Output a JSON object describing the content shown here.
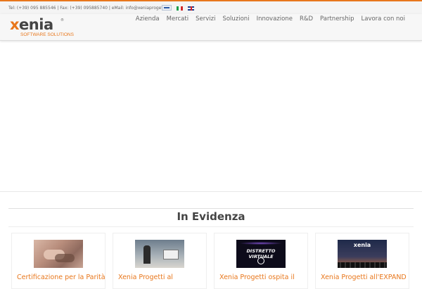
{
  "topbar": {
    "contact": "Tel: (+39) 095 885546 | Fax: (+39) 095885740 | eMail: info@xeniaprogetti.it",
    "languages": [
      "Italiano",
      "English"
    ]
  },
  "brand": {
    "name_x": "x",
    "name_rest": "enia",
    "registered": "®",
    "tagline": "SOFTWARE SOLUTIONS",
    "accent_color": "#e8771c"
  },
  "nav": {
    "items": [
      "Azienda",
      "Mercati",
      "Servizi",
      "Soluzioni",
      "Innovazione",
      "R&D",
      "Partnership",
      "Lavora con noi"
    ]
  },
  "featured": {
    "title": "In Evidenza",
    "cards": [
      {
        "title": "Certificazione per la Parità",
        "thumb_text": ""
      },
      {
        "title": "Xenia Progetti al",
        "thumb_text": ""
      },
      {
        "title": "Xenia Progetti ospita il",
        "thumb_text": "DISTRETTO VIRTUALE"
      },
      {
        "title": "Xenia Progetti all'EXPAND",
        "thumb_text": "xenia"
      }
    ]
  }
}
